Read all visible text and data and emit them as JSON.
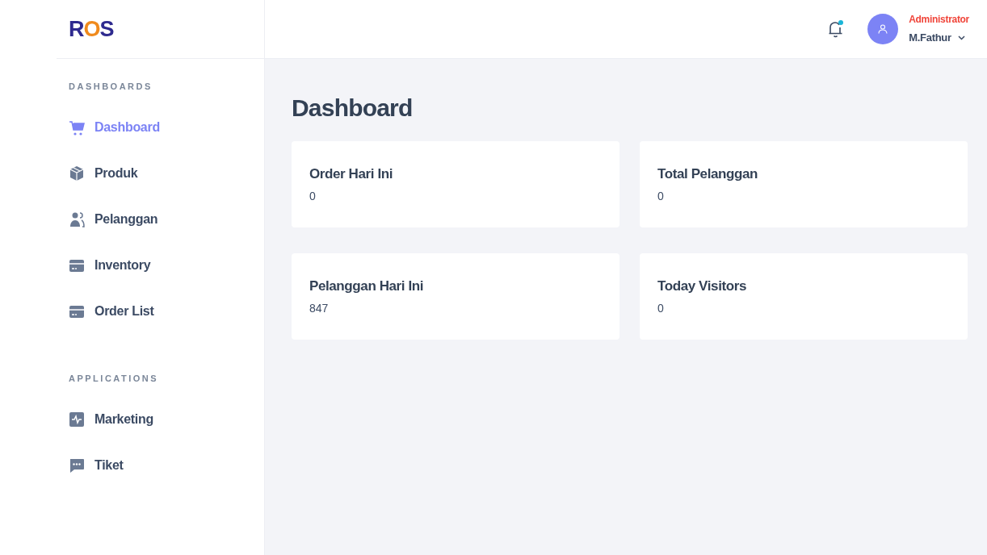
{
  "logo": [
    {
      "text": "R",
      "color": "#2e2a8f"
    },
    {
      "text": "O",
      "color": "#f08a1c"
    },
    {
      "text": "S",
      "color": "#2e2a8f"
    }
  ],
  "header": {
    "notification_dot": true,
    "role": "Administrator",
    "user": "M.Fathur"
  },
  "sidebar": {
    "sections": [
      {
        "title": "DASHBOARDS",
        "items": [
          {
            "label": "Dashboard",
            "kind": "cart",
            "selected": true
          },
          {
            "label": "Produk",
            "kind": "box",
            "selected": false
          },
          {
            "label": "Pelanggan",
            "kind": "users",
            "selected": false
          },
          {
            "label": "Inventory",
            "kind": "card",
            "selected": false
          },
          {
            "label": "Order List",
            "kind": "card",
            "selected": false
          }
        ]
      },
      {
        "title": "APPLICATIONS",
        "items": [
          {
            "label": "Marketing",
            "kind": "pulse",
            "selected": false
          },
          {
            "label": "Tiket",
            "kind": "chat",
            "selected": false
          }
        ]
      }
    ]
  },
  "page_title": "Dashboard",
  "cards": [
    {
      "title": "Order Hari Ini",
      "value": "0"
    },
    {
      "title": "Total Pelanggan",
      "value": "0"
    },
    {
      "title": "Pelanggan Hari Ini",
      "value": "847"
    },
    {
      "title": "Today Visitors",
      "value": "0"
    }
  ]
}
